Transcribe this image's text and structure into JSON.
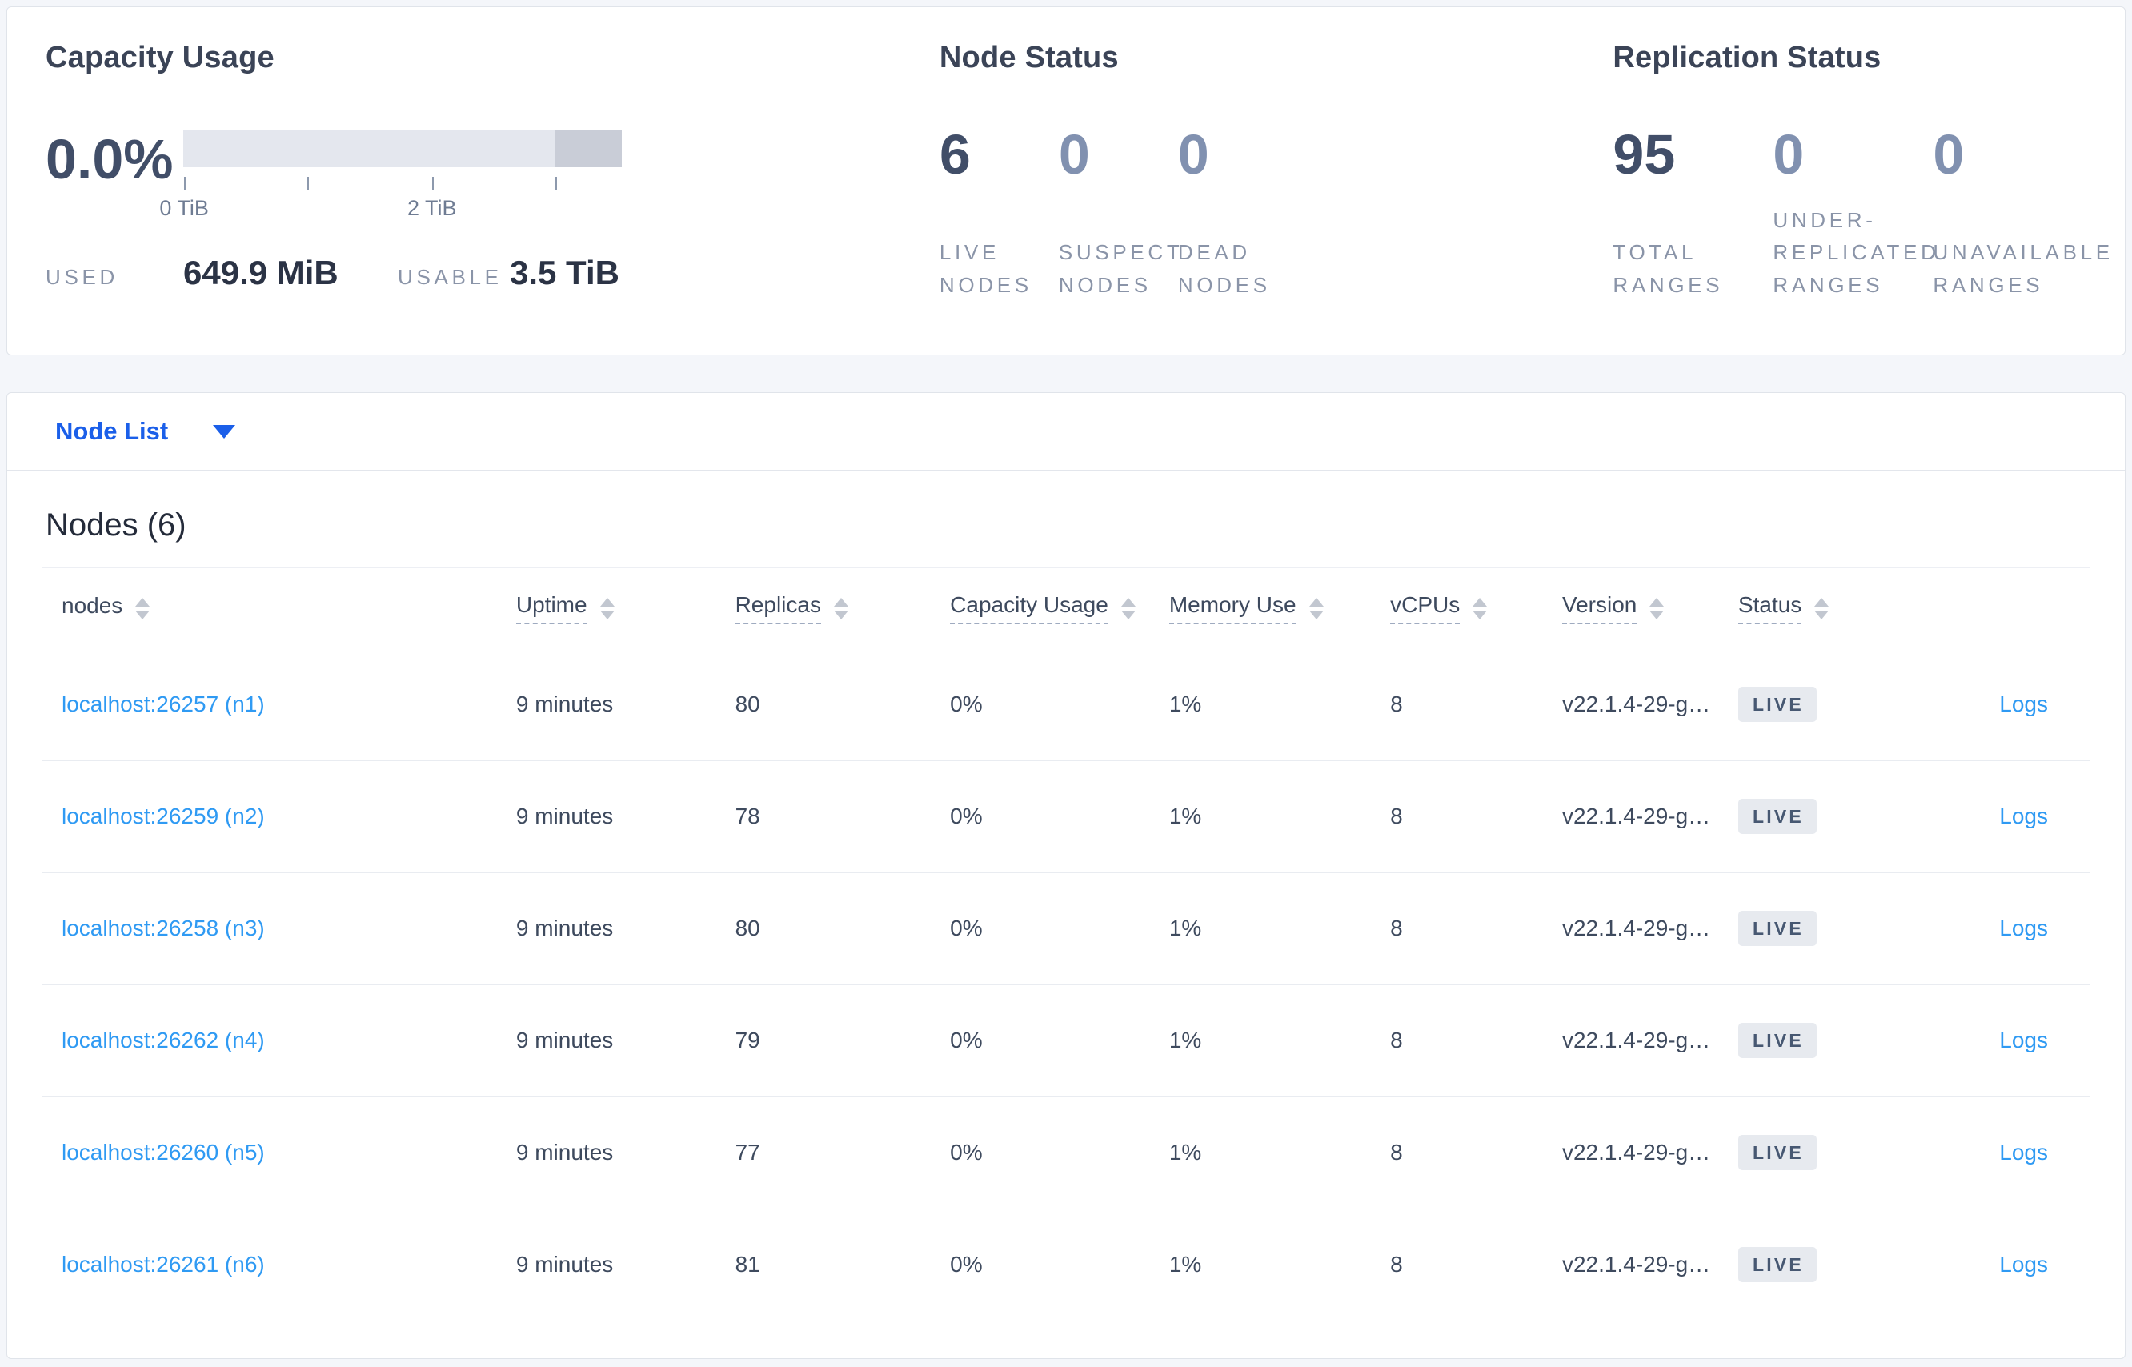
{
  "summary": {
    "capacity": {
      "title": "Capacity Usage",
      "percent": "0.0%",
      "axis_ticks": [
        {
          "pos_pct": 0.2,
          "label": "0 TiB"
        },
        {
          "pos_pct": 28.3,
          "label": ""
        },
        {
          "pos_pct": 56.7,
          "label": "2 TiB"
        },
        {
          "pos_pct": 84.9,
          "label": ""
        }
      ],
      "bar": {
        "dark_segment_start_pct": 84.9
      },
      "used_label": "USED",
      "used_value": "649.9 MiB",
      "usable_label": "USABLE",
      "usable_value": "3.5 TiB"
    },
    "node_status": {
      "title": "Node Status",
      "stats": [
        {
          "value": "6",
          "label": "LIVE NODES",
          "primary": true
        },
        {
          "value": "0",
          "label": "SUSPECT NODES",
          "primary": false
        },
        {
          "value": "0",
          "label": "DEAD NODES",
          "primary": false
        }
      ]
    },
    "replication_status": {
      "title": "Replication Status",
      "stats": [
        {
          "value": "95",
          "label": "TOTAL RANGES",
          "primary": true
        },
        {
          "value": "0",
          "label": "UNDER-REPLICATED RANGES",
          "primary": false
        },
        {
          "value": "0",
          "label": "UNAVAILABLE RANGES",
          "primary": false
        }
      ]
    }
  },
  "view_selector": {
    "label": "Node List"
  },
  "table": {
    "title": "Nodes (6)",
    "columns": [
      {
        "label": "nodes",
        "dashed": false
      },
      {
        "label": "Uptime",
        "dashed": true
      },
      {
        "label": "Replicas",
        "dashed": true
      },
      {
        "label": "Capacity Usage",
        "dashed": true
      },
      {
        "label": "Memory Use",
        "dashed": true
      },
      {
        "label": "vCPUs",
        "dashed": true
      },
      {
        "label": "Version",
        "dashed": true
      },
      {
        "label": "Status",
        "dashed": true
      }
    ],
    "rows": [
      {
        "node": "localhost:26257 (n1)",
        "uptime": "9 minutes",
        "replicas": "80",
        "capacity": "0%",
        "memory": "1%",
        "vcpus": "8",
        "version": "v22.1.4-29-g…",
        "status": "LIVE",
        "logs": "Logs"
      },
      {
        "node": "localhost:26259 (n2)",
        "uptime": "9 minutes",
        "replicas": "78",
        "capacity": "0%",
        "memory": "1%",
        "vcpus": "8",
        "version": "v22.1.4-29-g…",
        "status": "LIVE",
        "logs": "Logs"
      },
      {
        "node": "localhost:26258 (n3)",
        "uptime": "9 minutes",
        "replicas": "80",
        "capacity": "0%",
        "memory": "1%",
        "vcpus": "8",
        "version": "v22.1.4-29-g…",
        "status": "LIVE",
        "logs": "Logs"
      },
      {
        "node": "localhost:26262 (n4)",
        "uptime": "9 minutes",
        "replicas": "79",
        "capacity": "0%",
        "memory": "1%",
        "vcpus": "8",
        "version": "v22.1.4-29-g…",
        "status": "LIVE",
        "logs": "Logs"
      },
      {
        "node": "localhost:26260 (n5)",
        "uptime": "9 minutes",
        "replicas": "77",
        "capacity": "0%",
        "memory": "1%",
        "vcpus": "8",
        "version": "v22.1.4-29-g…",
        "status": "LIVE",
        "logs": "Logs"
      },
      {
        "node": "localhost:26261 (n6)",
        "uptime": "9 minutes",
        "replicas": "81",
        "capacity": "0%",
        "memory": "1%",
        "vcpus": "8",
        "version": "v22.1.4-29-g…",
        "status": "LIVE",
        "logs": "Logs"
      }
    ]
  },
  "colors": {
    "accent_blue": "#1b5fe9",
    "link_blue": "#2f9af3",
    "bar_light": "#e4e7ee",
    "bar_dark": "#c9cdd7",
    "badge_bg": "#e7eaef",
    "badge_text": "#475872",
    "page_bg": "#f4f6fa"
  }
}
